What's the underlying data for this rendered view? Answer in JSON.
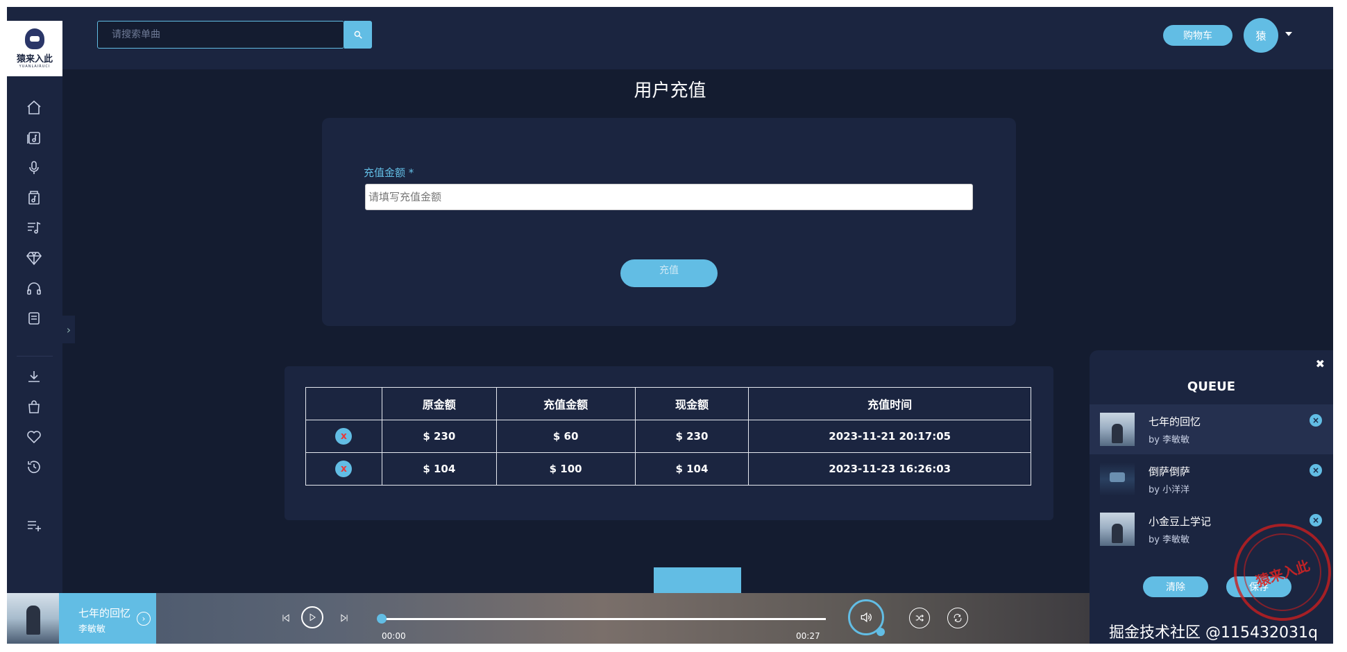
{
  "brand": {
    "name": "猿来入此",
    "sub": "YUANLAIRUCI"
  },
  "header": {
    "search_placeholder": "请搜索单曲",
    "cart_label": "购物车",
    "avatar_text": "猿"
  },
  "sidebar": {
    "icons": [
      "home-icon",
      "albums-icon",
      "microphone-icon",
      "music-box-icon",
      "playlist-icon",
      "diamond-icon",
      "headphones-icon",
      "document-icon",
      "download-icon",
      "shopping-bag-icon",
      "heart-icon",
      "history-icon",
      "playlist-add-icon"
    ]
  },
  "page": {
    "title": "用户充值",
    "amount_label": "充值金额",
    "required_mark": "*",
    "amount_placeholder": "请填写充值金额",
    "submit_label": "充值"
  },
  "history": {
    "columns": [
      "",
      "原金额",
      "充值金额",
      "现金额",
      "充值时间"
    ],
    "delete_glyph": "x",
    "rows": [
      {
        "original": "$ 230",
        "recharge": "$ 60",
        "current": "$ 230",
        "time": "2023-11-21 20:17:05"
      },
      {
        "original": "$ 104",
        "recharge": "$ 100",
        "current": "$ 104",
        "time": "2023-11-23 16:26:03"
      }
    ]
  },
  "queue": {
    "title": "QUEUE",
    "close_glyph": "✖",
    "items": [
      {
        "song": "七年的回忆",
        "artist": "by 李敏敏"
      },
      {
        "song": "倒萨倒萨",
        "artist": "by 小洋洋"
      },
      {
        "song": "小金豆上学记",
        "artist": "by 李敏敏"
      }
    ],
    "clear_label": "清除",
    "save_label": "保存"
  },
  "player": {
    "song": "七年的回忆",
    "artist": "李敏敏",
    "current_time": "00:00",
    "duration": "00:27",
    "progress": 0
  },
  "watermark": {
    "text": "掘金技术社区 @115432031q",
    "stamp_text": "猿来入此"
  },
  "colors": {
    "accent": "#62bde4",
    "background": "#141c30",
    "panel": "#1b2540",
    "danger": "#e83a3a"
  }
}
